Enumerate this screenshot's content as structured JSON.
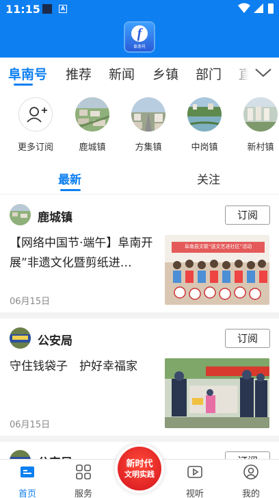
{
  "status_bar": {
    "time": "11:15",
    "notif_glyph": "A"
  },
  "header": {
    "logo_letter": "f",
    "logo_caption": "阜南号"
  },
  "channel_tabs": [
    "阜南号",
    "推荐",
    "新闻",
    "乡镇",
    "部门",
    "直"
  ],
  "subscriptions": [
    {
      "label": "更多订阅",
      "icon": "add-user-icon"
    },
    {
      "label": "鹿城镇"
    },
    {
      "label": "方集镇"
    },
    {
      "label": "中岗镇"
    },
    {
      "label": "新村镇"
    }
  ],
  "feed_tabs": {
    "latest": "最新",
    "follow": "关注"
  },
  "cards": [
    {
      "source": "鹿城镇",
      "subscribe": "订阅",
      "title": "【网络中国节·端午】阜南开展”非遗文化暨剪纸进…",
      "date": "06月15日",
      "image_banner": "阜南县文联“送文艺进社区”活动"
    },
    {
      "source": "公安局",
      "subscribe": "订阅",
      "title": "守住钱袋子　护好幸福家",
      "date": "06月15日"
    },
    {
      "source": "公安局",
      "subscribe": "订阅"
    }
  ],
  "bottom_nav": {
    "home": "首页",
    "services": "服务",
    "center_line1": "新时代",
    "center_line2": "文明实践",
    "video": "视听",
    "mine": "我的"
  },
  "colors": {
    "primary": "#0d7ff0",
    "center_red": "#e0202a"
  }
}
